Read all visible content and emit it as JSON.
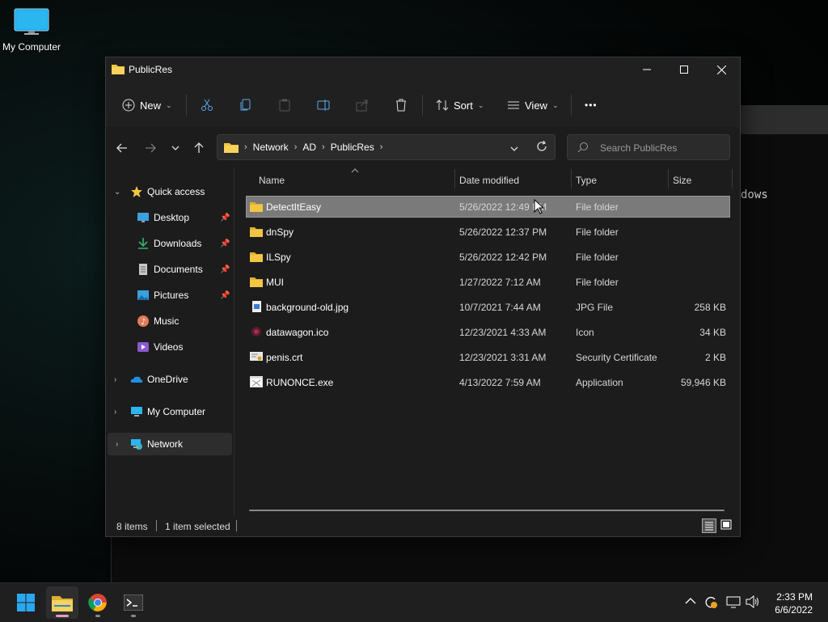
{
  "desktop": {
    "icon_label": "My Computer"
  },
  "terminal": {
    "visible_text": "dows"
  },
  "window": {
    "title": "PublicRes",
    "controls": {
      "minimize": "—",
      "maximize": "☐",
      "close": "✕"
    }
  },
  "toolbar": {
    "new_label": "New",
    "sort_label": "Sort",
    "view_label": "View",
    "more_label": "•••"
  },
  "address": {
    "crumbs": [
      "Network",
      "AD",
      "PublicRes"
    ]
  },
  "search": {
    "placeholder": "Search PublicRes"
  },
  "nav": {
    "quick_access": "Quick access",
    "items": [
      {
        "label": "Desktop",
        "icon": "desktop-icon",
        "pinned": true
      },
      {
        "label": "Downloads",
        "icon": "downloads-icon",
        "pinned": true
      },
      {
        "label": "Documents",
        "icon": "documents-icon",
        "pinned": true
      },
      {
        "label": "Pictures",
        "icon": "pictures-icon",
        "pinned": true
      },
      {
        "label": "Music",
        "icon": "music-icon",
        "pinned": false
      },
      {
        "label": "Videos",
        "icon": "videos-icon",
        "pinned": false
      }
    ],
    "onedrive": "OneDrive",
    "my_computer": "My Computer",
    "network": "Network"
  },
  "columns": {
    "name": "Name",
    "date": "Date modified",
    "type": "Type",
    "size": "Size"
  },
  "files": [
    {
      "name": "DetectItEasy",
      "date": "5/26/2022 12:49 PM",
      "type": "File folder",
      "size": "",
      "kind": "folder",
      "selected": true
    },
    {
      "name": "dnSpy",
      "date": "5/26/2022 12:37 PM",
      "type": "File folder",
      "size": "",
      "kind": "folder"
    },
    {
      "name": "ILSpy",
      "date": "5/26/2022 12:42 PM",
      "type": "File folder",
      "size": "",
      "kind": "folder"
    },
    {
      "name": "MUI",
      "date": "1/27/2022 7:12 AM",
      "type": "File folder",
      "size": "",
      "kind": "folder"
    },
    {
      "name": "background-old.jpg",
      "date": "10/7/2021 7:44 AM",
      "type": "JPG File",
      "size": "258 KB",
      "kind": "image"
    },
    {
      "name": "datawagon.ico",
      "date": "12/23/2021 4:33 AM",
      "type": "Icon",
      "size": "34 KB",
      "kind": "icon"
    },
    {
      "name": "penis.crt",
      "date": "12/23/2021 3:31 AM",
      "type": "Security Certificate",
      "size": "2 KB",
      "kind": "cert"
    },
    {
      "name": "RUNONCE.exe",
      "date": "4/13/2022 7:59 AM",
      "type": "Application",
      "size": "59,946 KB",
      "kind": "exe"
    }
  ],
  "status": {
    "count": "8 items",
    "selection": "1 item selected"
  },
  "taskbar": {
    "time": "2:33 PM",
    "date": "6/6/2022"
  },
  "colors": {
    "accent": "#0078d4",
    "folder": "#f4c542",
    "selection": "#7a7a7a"
  }
}
